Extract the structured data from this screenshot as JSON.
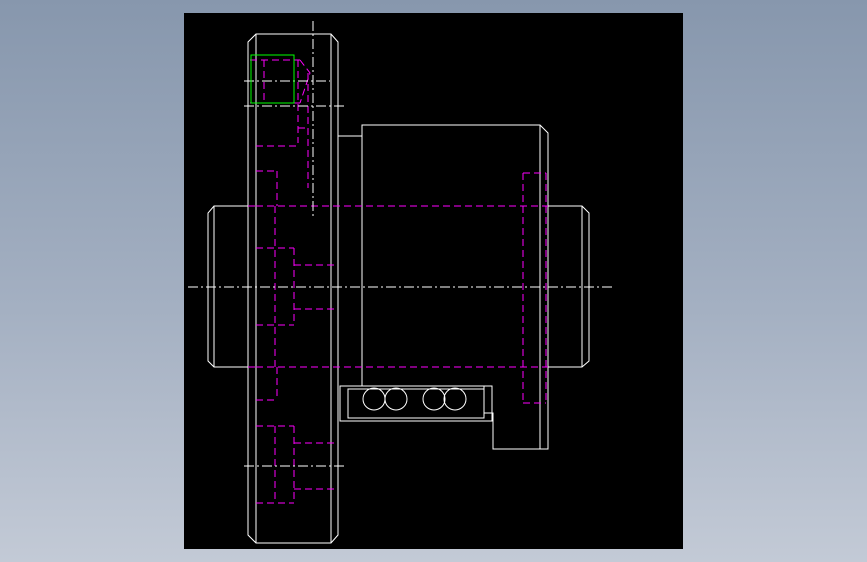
{
  "viewport": {
    "background": "#000000",
    "page_gradient": [
      "#8797ad",
      "#a4b0c2",
      "#c3cad6"
    ]
  },
  "drawing": {
    "colors": {
      "visible_edge": "#ffffff",
      "hidden_line": "#ff00ff",
      "center_line": "#ffffff",
      "highlight": "#00ff00"
    }
  }
}
